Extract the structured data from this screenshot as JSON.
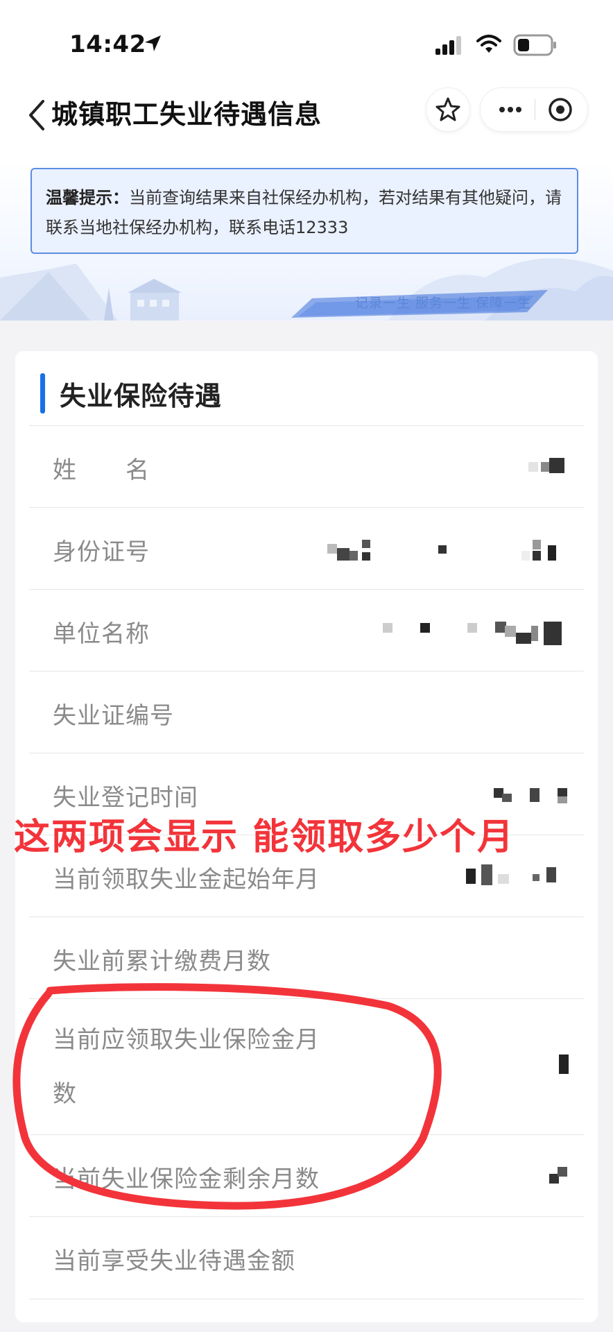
{
  "status_bar": {
    "time": "14:42"
  },
  "nav": {
    "title": "城镇职工失业待遇信息"
  },
  "notice": {
    "label": "温馨提示：",
    "text": "当前查询结果来自社保经办机构，若对结果有其他疑问，请联系当地社保经办机构，联系电话12333"
  },
  "banner": {
    "slogan": "记录一生 服务一生 保障一生"
  },
  "section": {
    "title": "失业保险待遇"
  },
  "rows": [
    {
      "label": "姓　　名"
    },
    {
      "label": "身份证号"
    },
    {
      "label": "单位名称"
    },
    {
      "label": "失业证编号"
    },
    {
      "label": "失业登记时间"
    },
    {
      "label": "当前领取失业金起始年月"
    },
    {
      "label": "失业前累计缴费月数"
    },
    {
      "label": "当前应领取失业保险金月\n数"
    },
    {
      "label": "当前失业保险金剩余月数"
    },
    {
      "label": "当前享受失业待遇金额"
    }
  ],
  "annotation": {
    "text": "这两项会显示 能领取多少个月"
  },
  "colors": {
    "accent": "#1a6fe6",
    "notice_border": "#5c8de0",
    "annotation": "#f2343a"
  }
}
